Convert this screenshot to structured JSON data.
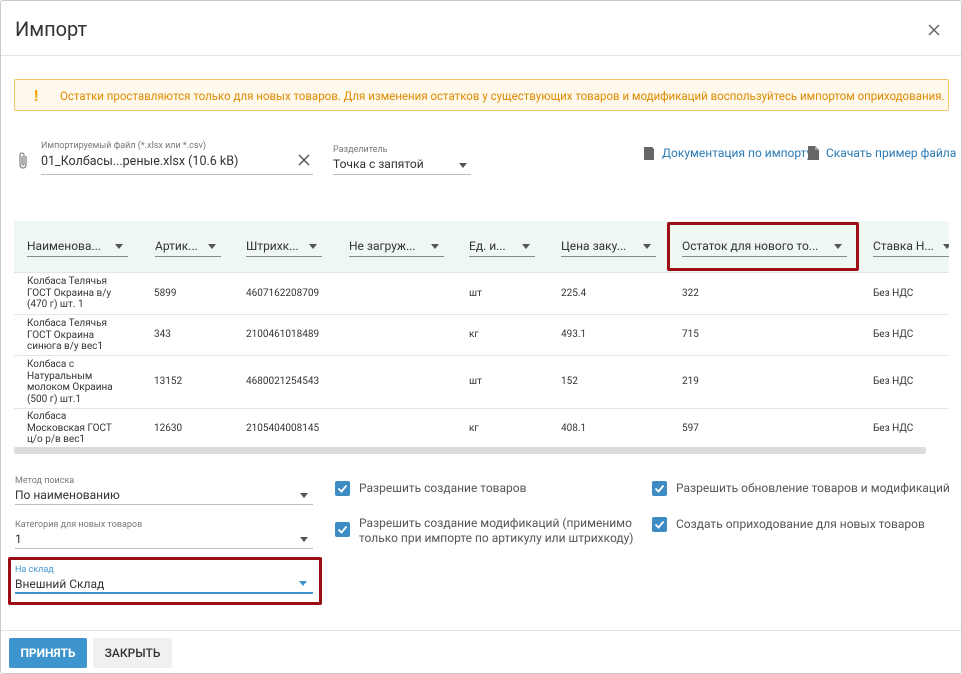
{
  "dialog": {
    "title": "Импорт"
  },
  "alert": {
    "icon": "exclamation-icon",
    "text": "Остатки проставляются только для новых товаров. Для изменения остатков у существующих товаров и модификаций воспользуйтесь импортом оприходования."
  },
  "file": {
    "label": "Импортируемый файл (*.xlsx или *.csv)",
    "value": "01_Колбасы...реные.xlsx (10.6 kB)"
  },
  "separator": {
    "label": "Разделитель",
    "value": "Точка с запятой"
  },
  "links": {
    "docs": "Документация по импорту",
    "sample": "Скачать пример файла"
  },
  "table": {
    "columns": [
      "Наименова...",
      "Артик...",
      "Штрихк...",
      "Не загруж...",
      "Ед. и...",
      "Цена заку...",
      "Остаток для нового то...",
      "Ставка Н..."
    ],
    "rows": [
      {
        "name": [
          "Колбаса Телячья",
          "ГОСТ Окраина в/у",
          "(470 г) шт. 1"
        ],
        "article": "5899",
        "barcode": "4607162208709",
        "skip": "",
        "unit": "шт",
        "price": "225.4",
        "stock": "322",
        "vat": "Без НДС"
      },
      {
        "name": [
          "Колбаса Телячья",
          "ГОСТ Окраина",
          "синюга в/у вес1"
        ],
        "article": "343",
        "barcode": "2100461018489",
        "skip": "",
        "unit": "кг",
        "price": "493.1",
        "stock": "715",
        "vat": "Без НДС"
      },
      {
        "name": [
          "Колбаса с",
          "Натуральным",
          "молоком Окраина",
          "(500 г) шт.1"
        ],
        "article": "13152",
        "barcode": "4680021254543",
        "skip": "",
        "unit": "шт",
        "price": "152",
        "stock": "219",
        "vat": "Без НДС"
      },
      {
        "name": [
          "Колбаса",
          "Московская ГОСТ",
          "ц/о р/в вес1"
        ],
        "article": "12630",
        "barcode": "2105404008145",
        "skip": "",
        "unit": "кг",
        "price": "408.1",
        "stock": "597",
        "vat": "Без НДС"
      }
    ]
  },
  "search_method": {
    "label": "Метод поиска",
    "value": "По наименованию"
  },
  "category": {
    "label": "Категория для новых товаров",
    "value": "1"
  },
  "warehouse": {
    "label": "На склад",
    "value": "Внешний Склад"
  },
  "options": {
    "allow_create_products": "Разрешить создание товаров",
    "allow_create_mods_line1": "Разрешить создание модификаций (применимо",
    "allow_create_mods_line2": "только при импорте по артикулу или штрихкоду)",
    "allow_update": "Разрешить обновление товаров и модификаций",
    "create_receipt": "Создать оприходование для новых товаров"
  },
  "buttons": {
    "accept": "ПРИНЯТЬ",
    "close": "ЗАКРЫТЬ"
  },
  "colors": {
    "accent": "#3e95cd",
    "highlight": "#9b0e16",
    "alert_text": "#e08a00"
  }
}
